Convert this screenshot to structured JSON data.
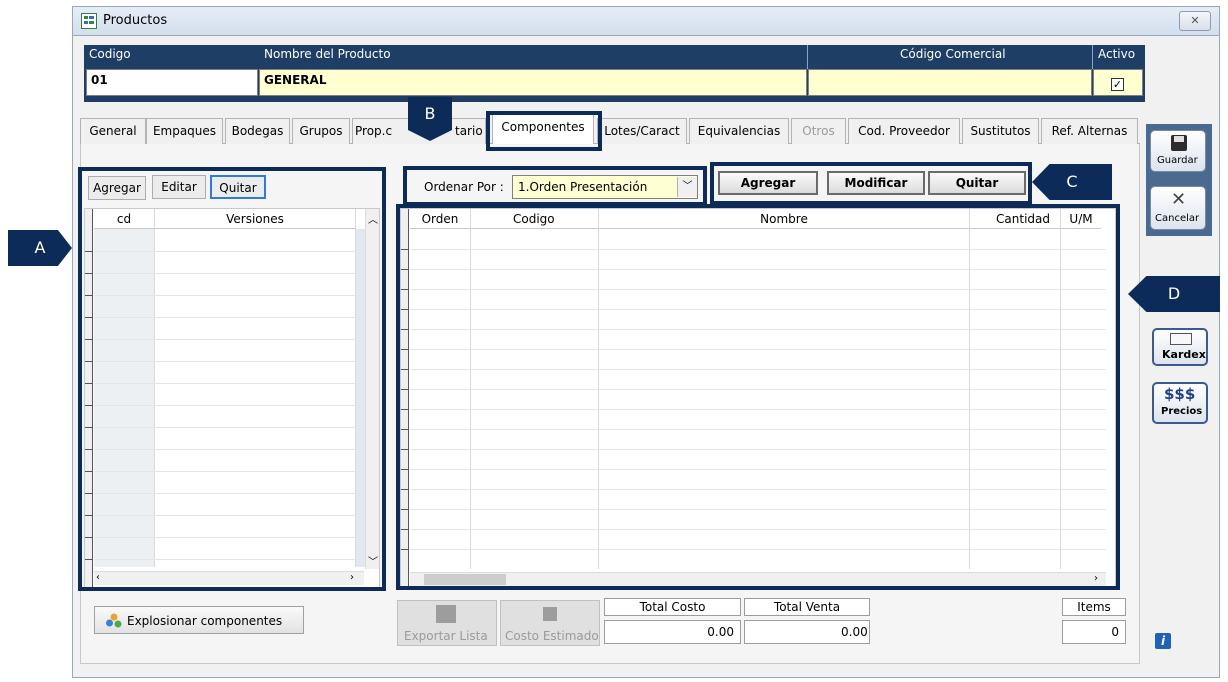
{
  "window": {
    "title": "Productos",
    "close_glyph": "✕",
    "icon": "product-form-icon"
  },
  "header": {
    "codigo_label": "Codigo",
    "nombre_label": "Nombre del Producto",
    "codigo_comercial_label": "Código Comercial",
    "activo_label": "Activo",
    "codigo_value": "01",
    "nombre_value": "GENERAL",
    "codigo_comercial_value": "",
    "activo_checked": true
  },
  "tabs": [
    "General",
    "Empaques",
    "Bodegas",
    "Grupos",
    "Prop.c",
    "tario",
    "Componentes",
    "Lotes/Caract",
    "Equivalencias",
    "Otros",
    "Cod. Proveedor",
    "Sustitutos",
    "Ref. Alternas"
  ],
  "active_tab": "Componentes",
  "left": {
    "buttons": {
      "agregar": "Agregar",
      "editar": "Editar",
      "quitar": "Quitar"
    },
    "columns": [
      "cd",
      "Versiones"
    ]
  },
  "order": {
    "label": "Ordenar Por :",
    "value": "1.Orden Presentación"
  },
  "actions": {
    "agregar": "Agregar",
    "modificar": "Modificar",
    "quitar": "Quitar"
  },
  "grid": {
    "columns": [
      "Orden",
      "Codigo",
      "Nombre",
      "Cantidad",
      "U/M"
    ]
  },
  "footer": {
    "explosionar": "Explosionar componentes",
    "exportar": "Exportar Lista",
    "costo_estimado": "Costo Estimado",
    "total_costo_label": "Total Costo",
    "total_costo_value": "0.00",
    "total_venta_label": "Total Venta",
    "total_venta_value": "0.00",
    "items_label": "Items",
    "items_value": "0"
  },
  "sidebar": {
    "guardar": "Guardar",
    "cancelar": "Cancelar",
    "kardex": "Kardex",
    "precios_symbol": "$$$",
    "precios": "Precios",
    "info": "i"
  },
  "annotations": {
    "a": "A",
    "b": "B",
    "c": "C",
    "d": "D"
  },
  "colors": {
    "header_bg": "#1f3e66",
    "field_bg": "#ffffd2",
    "annotation": "#0d2b58",
    "sidebar": "#4b6a90"
  }
}
